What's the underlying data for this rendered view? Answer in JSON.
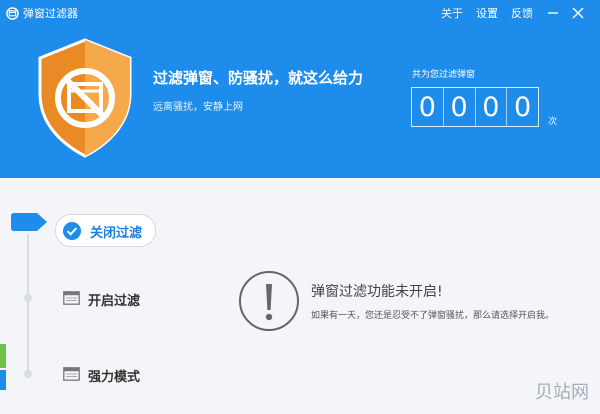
{
  "titlebar": {
    "app_title": "弹窗过滤器",
    "menu": {
      "about": "关于",
      "settings": "设置",
      "feedback": "反馈"
    }
  },
  "hero": {
    "headline": "过滤弹窗、防骚扰，就这么给力",
    "subline": "远离骚扰，安静上网",
    "count_label": "共为您过滤弹窗",
    "count_digits": [
      "0",
      "0",
      "0",
      "0"
    ],
    "count_unit": "次"
  },
  "nav": {
    "close_filter": "关闭过滤",
    "open_filter": "开启过滤",
    "strong_mode": "强力模式"
  },
  "alert": {
    "title": "弹窗过滤功能未开启!",
    "desc": "如果有一天，您还是忍受不了弹窗骚扰，那么请选择开启我。"
  },
  "watermark": "贝站网",
  "colors": {
    "header_blue": "#1d8ceb",
    "shield_orange": "#f0992e",
    "active_blue": "#1f7fe0"
  },
  "icons": [
    "app-logo-icon",
    "minimize-icon",
    "close-icon",
    "shield-block-icon",
    "checkmark-icon",
    "window-icon",
    "exclamation-icon"
  ]
}
